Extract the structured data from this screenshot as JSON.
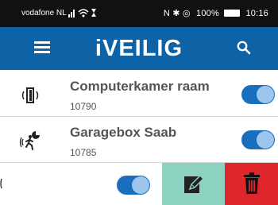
{
  "status_bar": {
    "carrier": "vodafone NL",
    "right_glyphs": "N ✱ ◎",
    "battery": "100%",
    "time": "10:16"
  },
  "app_bar": {
    "title": "iVEILIG",
    "menu_icon": "hamburger-menu-icon",
    "search_icon": "search-icon"
  },
  "sensors": [
    {
      "name": "Computerkamer raam",
      "code": "10790",
      "icon": "window-sensor-icon",
      "enabled": true
    },
    {
      "name": "Garagebox Saab",
      "code": "10785",
      "icon": "motion-sensor-icon",
      "enabled": true
    },
    {
      "enabled": true
    }
  ],
  "swipe_actions": {
    "edit_icon": "edit-icon",
    "delete_icon": "trash-icon",
    "edit_color": "#8dd2c0",
    "delete_color": "#e0262a"
  },
  "colors": {
    "appbar": "#0d63a5",
    "toggle_on": "#1a6fbd"
  }
}
